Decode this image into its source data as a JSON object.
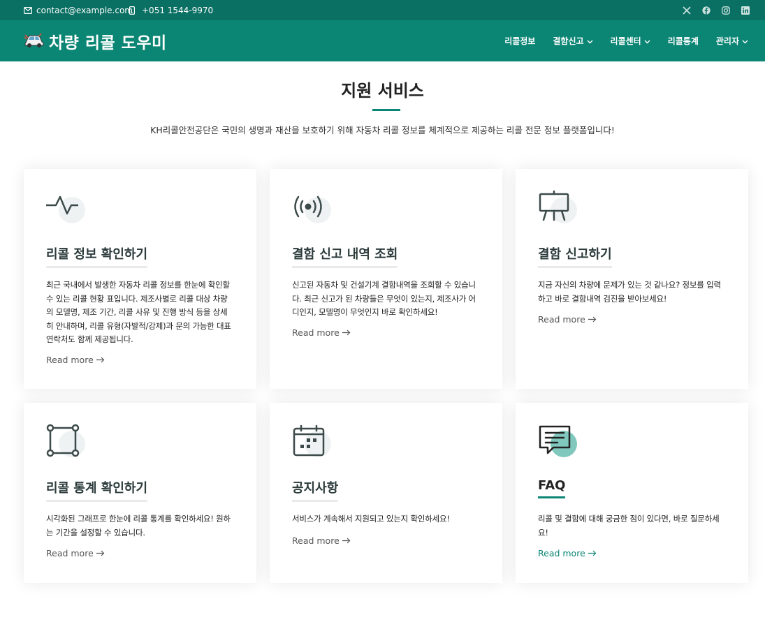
{
  "topbar": {
    "email": "contact@example.com",
    "phone": "+051 1544-9970"
  },
  "header": {
    "site_title": "차량 리콜 도우미",
    "nav": [
      {
        "label": "리콜정보",
        "has_dropdown": false
      },
      {
        "label": "결함신고",
        "has_dropdown": true
      },
      {
        "label": "리콜센터",
        "has_dropdown": true
      },
      {
        "label": "리콜통계",
        "has_dropdown": false
      },
      {
        "label": "관리자",
        "has_dropdown": true
      }
    ]
  },
  "section": {
    "title": "지원 서비스",
    "description": "KH리콜안전공단은 국민의 생명과 재산을 보호하기 위해 자동차 리콜 정보를 체계적으로 제공하는 리콜 전문 정보 플랫폼입니다!"
  },
  "cards": [
    {
      "icon": "activity-icon",
      "title": "리콜 정보 확인하기",
      "text": "최근 국내에서 발생한 자동차 리콜 정보를 한눈에 확인할 수 있는 리콜 현황 표입니다. 제조사별로 리콜 대상 차량의 모델명, 제조 기간, 리콜 사유 및 진행 방식 등을 상세히 안내하며, 리콜 유형(자발적/강제)과 문의 가능한 대표 연락처도 함께 제공됩니다.",
      "more": "Read more"
    },
    {
      "icon": "broadcast-icon",
      "title": "결함 신고 내역 조회",
      "text": "신고된 자동차 및 건설기계 결함내역을 조회할 수 있습니다. 최근 신고가 된 차량들은 무엇이 있는지, 제조사가 어디인지, 모델명이 무엇인지 바로 확인하세요!",
      "more": "Read more"
    },
    {
      "icon": "easel-icon",
      "title": "결함 신고하기",
      "text": "지금 자신의 차량에 문제가 있는 것 같나요? 정보를 입력하고 바로 결함내역 검진을 받아보세요!",
      "more": "Read more"
    },
    {
      "icon": "bounding-box-icon",
      "title": "리콜 통계 확인하기",
      "text": "시각화된 그래프로 한눈에 리콜 통계를 확인하세요! 원하는 기간을 설정할 수 있습니다.",
      "more": "Read more"
    },
    {
      "icon": "calendar-icon",
      "title": "공지사항",
      "text": "서비스가 계속해서 지원되고 있는지 확인하세요!",
      "more": "Read more"
    },
    {
      "icon": "chat-icon",
      "title": "FAQ",
      "text": "리콜 및 결함에 대해 궁금한 점이 있다면, 바로 질문하세요!",
      "more": "Read more"
    }
  ],
  "colors": {
    "topbar": "#0a7063",
    "header": "#0b8574",
    "accent": "#0b8574"
  }
}
